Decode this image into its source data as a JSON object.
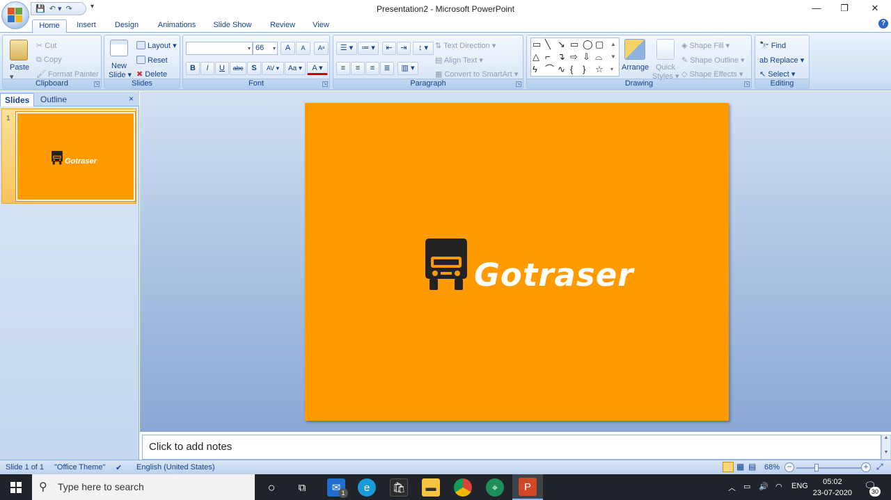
{
  "window": {
    "title": "Presentation2 - Microsoft PowerPoint",
    "minimize_glyph": "—",
    "restore_glyph": "❐",
    "close_glyph": "✕"
  },
  "qat": {
    "save_icon": "save-icon",
    "undo_icon": "undo-icon",
    "redo_icon": "redo-icon"
  },
  "tabs": [
    "Home",
    "Insert",
    "Design",
    "Animations",
    "Slide Show",
    "Review",
    "View"
  ],
  "ribbon": {
    "clipboard": {
      "label": "Clipboard",
      "paste": "Paste",
      "cut": "Cut",
      "copy": "Copy",
      "format_painter": "Format Painter"
    },
    "slides": {
      "label": "Slides",
      "new_slide_line1": "New",
      "new_slide_line2": "Slide ▾",
      "layout": "Layout ▾",
      "reset": "Reset",
      "delete": "Delete"
    },
    "font": {
      "label": "Font",
      "font_name": "",
      "font_size": "66",
      "grow": "A",
      "shrink": "A",
      "clear": "Aᵃ",
      "bold": "B",
      "italic": "I",
      "underline": "U",
      "strike": "abc",
      "shadow": "S",
      "spacing": "AV ▾",
      "case": "Aa ▾",
      "color": "A ▾"
    },
    "paragraph": {
      "label": "Paragraph",
      "text_direction": "Text Direction ▾",
      "align_text": "Align Text ▾",
      "convert_smartart": "Convert to SmartArt ▾"
    },
    "drawing": {
      "label": "Drawing",
      "arrange": "Arrange",
      "quick_styles_1": "Quick",
      "quick_styles_2": "Styles ▾",
      "shape_fill": "Shape Fill ▾",
      "shape_outline": "Shape Outline ▾",
      "shape_effects": "Shape Effects ▾"
    },
    "editing": {
      "label": "Editing",
      "find": "Find",
      "replace": "Replace ▾",
      "select": "Select ▾"
    }
  },
  "slides_pane": {
    "tab_slides": "Slides",
    "tab_outline": "Outline",
    "close": "×",
    "thumb_number": "1",
    "thumb_text": "Gotraser"
  },
  "slide": {
    "text": "Gotraser",
    "background": "#ff9a00"
  },
  "notes": {
    "placeholder": "Click to add notes"
  },
  "status": {
    "slide_counter": "Slide 1 of 1",
    "theme": "\"Office Theme\"",
    "language": "English (United States)",
    "zoom": "68%",
    "zoom_minus": "−",
    "zoom_plus": "+"
  },
  "taskbar": {
    "search_placeholder": "Type here to search",
    "mail_badge": "1",
    "language": "ENG",
    "time": "05:02",
    "date": "23-07-2020",
    "notification_count": "30"
  }
}
